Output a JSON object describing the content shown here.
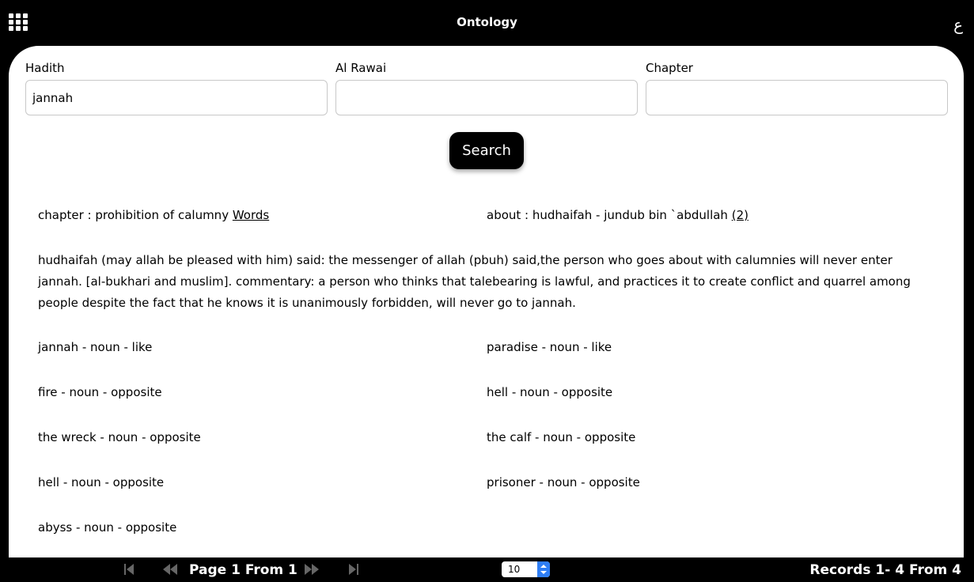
{
  "header": {
    "title": "Ontology",
    "lang_toggle": "ع",
    "menu_icon": "grid-menu-icon"
  },
  "search": {
    "hadith_label": "Hadith",
    "hadith_value": "jannah",
    "rawai_label": "Al Rawai",
    "rawai_value": "",
    "chapter_label": "Chapter",
    "chapter_value": "",
    "button": "Search"
  },
  "result": {
    "chapter_prefix": "chapter : prohibition of calumny ",
    "chapter_link": "Words",
    "about_prefix": "about : hudhaifah - jundub bin `abdullah ",
    "about_link": "(2)",
    "text": "hudhaifah (may allah be pleased with him) said: the messenger of allah (pbuh) said,the person who goes about with calumnies will never enter jannah. [al-bukhari and muslim]. commentary: a person who thinks that talebearing is lawful, and practices it to create conflict and quarrel among people despite the fact that he knows it is unanimously forbidden, will never go to jannah.",
    "terms": [
      "jannah - noun - like",
      "paradise - noun - like",
      "fire - noun - opposite",
      "hell - noun - opposite",
      "the wreck - noun - opposite",
      "the calf - noun - opposite",
      "hell - noun - opposite",
      "prisoner - noun - opposite",
      "abyss - noun - opposite"
    ]
  },
  "footer": {
    "page_label": "Page 1 From 1",
    "per_page": "10",
    "records": "Records 1- 4 From 4"
  },
  "colors": {
    "background": "#000000",
    "panel": "#ffffff",
    "spinner": "#2f7ef5"
  }
}
